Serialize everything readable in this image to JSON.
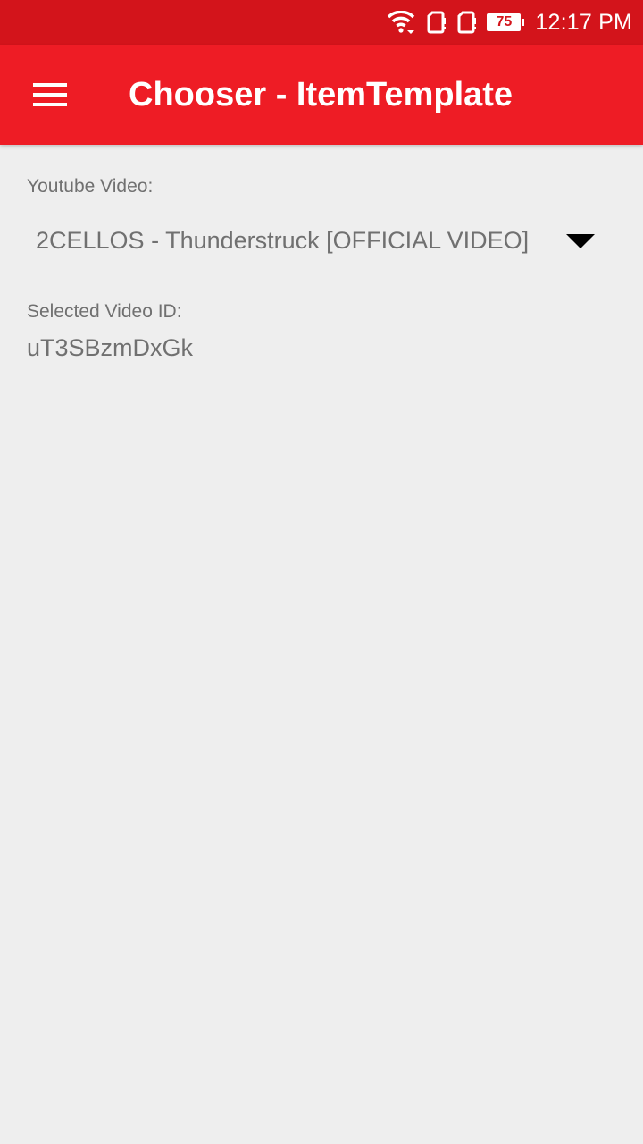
{
  "status_bar": {
    "battery_level": "75",
    "time": "12:17 PM",
    "icons": [
      "wifi-icon",
      "sim-card-icon",
      "sim-card-icon",
      "battery-icon"
    ],
    "background_color": "#d3141b"
  },
  "app_bar": {
    "title": "Chooser - ItemTemplate",
    "menu_icon": "hamburger-menu-icon",
    "background_color": "#ee1c25"
  },
  "form": {
    "video_label": "Youtube Video:",
    "video_selected": "2CELLOS - Thunderstruck [OFFICIAL VIDEO]",
    "dropdown_icon": "dropdown-arrow-icon",
    "id_label": "Selected Video ID:",
    "id_value": "uT3SBzmDxGk"
  }
}
